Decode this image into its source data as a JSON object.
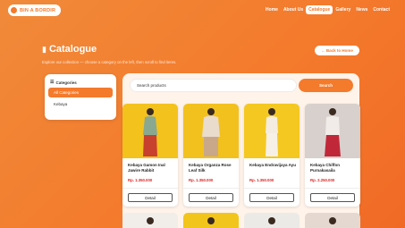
{
  "brand": {
    "name": "BIN A BORDIR",
    "logo_icon": "circle-logo-icon"
  },
  "nav": [
    "Home",
    "About Us",
    "Catalogue",
    "Gallery",
    "News",
    "Contact"
  ],
  "nav_active": "Catalogue",
  "header": {
    "title": "Catalogue",
    "subtitle": "Explore our collection — choose a category on the left, then scroll to find items.",
    "back_label": "← Back to Home"
  },
  "sidebar": {
    "heading": "Categories",
    "items": [
      "All Categories",
      "Kebaya"
    ],
    "active": "All Categories"
  },
  "search": {
    "placeholder": "Search products",
    "button": "Search"
  },
  "products": [
    {
      "name": "Kebaya Gamon Inal Jawire Rabbit",
      "price": "Rp. 1.350.000",
      "button": "Detail"
    },
    {
      "name": "Kebaya Organza Rose Leaf Silk",
      "price": "Rp. 1.350.000",
      "button": "Detail"
    },
    {
      "name": "Kebaya Endravijaya Ayu",
      "price": "Rp. 1.350.000",
      "button": "Detail"
    },
    {
      "name": "Kebaya Chiffon Purnakasaila",
      "price": "Rp. 2.250.000",
      "button": "Detail"
    }
  ],
  "colors": {
    "accent": "#f47a2c",
    "price": "#e02424",
    "card_backgrounds": [
      "#f3c21d",
      "#f2c11e",
      "#f4c820",
      "#d8d0cc",
      "#f1eeea",
      "#f2c51c",
      "#eceae6",
      "#e4d8d0"
    ]
  }
}
